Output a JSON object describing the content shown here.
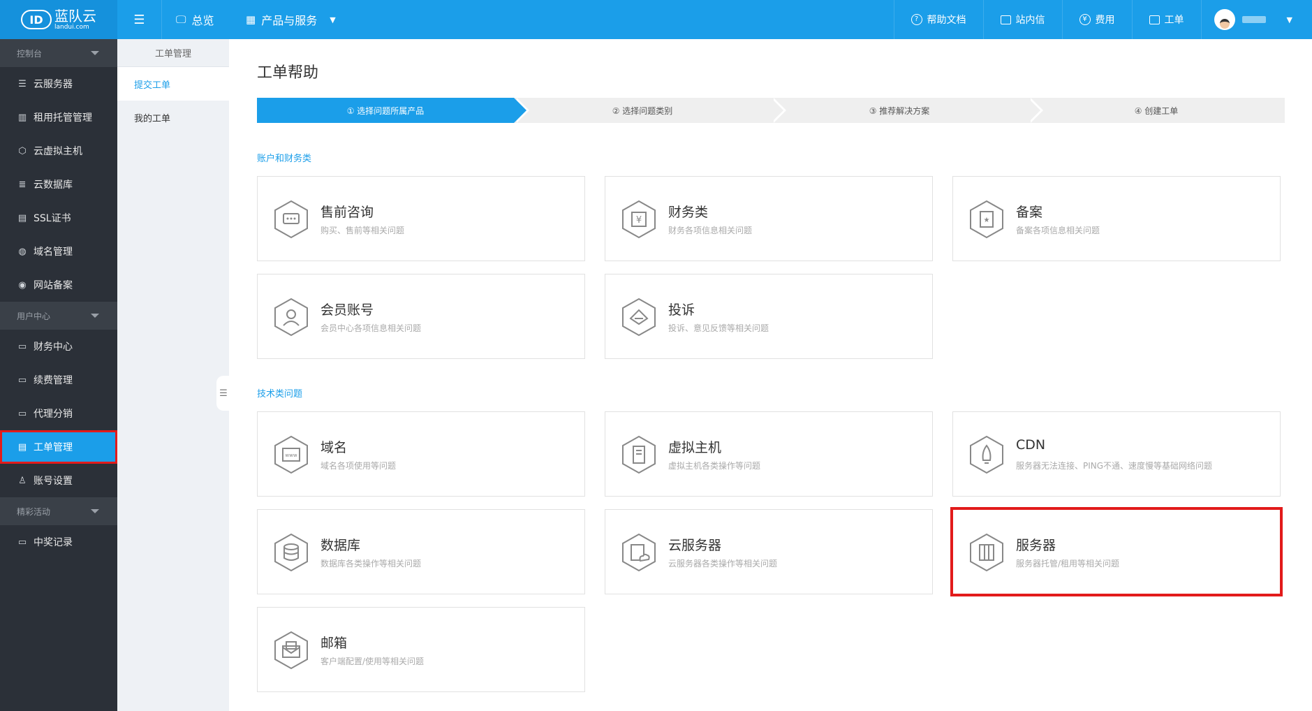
{
  "topbar": {
    "logo_cn": "蓝队云",
    "logo_en": "landui.com",
    "nav": [
      {
        "label": "总览",
        "icon": "monitor-icon"
      },
      {
        "label": "产品与服务",
        "icon": "grid-icon"
      }
    ],
    "right": [
      {
        "label": "帮助文档",
        "icon": "help-icon"
      },
      {
        "label": "站内信",
        "icon": "mail-icon"
      },
      {
        "label": "费用",
        "icon": "yen-icon"
      },
      {
        "label": "工单",
        "icon": "ticket-icon"
      }
    ]
  },
  "sidebar": {
    "groups": [
      {
        "label": "控制台",
        "items": [
          {
            "label": "云服务器",
            "icon": "server-icon"
          },
          {
            "label": "租用托管管理",
            "icon": "rack-icon"
          },
          {
            "label": "云虚拟主机",
            "icon": "cube-icon"
          },
          {
            "label": "云数据库",
            "icon": "database-icon"
          },
          {
            "label": "SSL证书",
            "icon": "certificate-icon"
          },
          {
            "label": "域名管理",
            "icon": "globe-icon"
          },
          {
            "label": "网站备案",
            "icon": "record-icon"
          }
        ]
      },
      {
        "label": "用户中心",
        "items": [
          {
            "label": "财务中心",
            "icon": "finance-icon"
          },
          {
            "label": "续费管理",
            "icon": "renew-icon"
          },
          {
            "label": "代理分销",
            "icon": "agent-icon"
          },
          {
            "label": "工单管理",
            "icon": "ticket-icon",
            "active": true
          },
          {
            "label": "账号设置",
            "icon": "user-icon"
          }
        ]
      },
      {
        "label": "精彩活动",
        "items": [
          {
            "label": "中奖记录",
            "icon": "prize-icon"
          }
        ]
      }
    ]
  },
  "submenu": {
    "header": "工单管理",
    "items": [
      "提交工单",
      "我的工单"
    ]
  },
  "main": {
    "title": "工单帮助",
    "steps": [
      "① 选择问题所属产品",
      "② 选择问题类别",
      "③ 推荐解决方案",
      "④ 创建工单"
    ],
    "sections": [
      {
        "title": "账户和财务类",
        "cards": [
          {
            "title": "售前咨询",
            "desc": "购买、售前等相关问题",
            "icon": "chat-icon"
          },
          {
            "title": "财务类",
            "desc": "财务各项信息相关问题",
            "icon": "yen-icon"
          },
          {
            "title": "备案",
            "desc": "备案各项信息相关问题",
            "icon": "record-icon"
          },
          {
            "title": "会员账号",
            "desc": "会员中心各项信息相关问题",
            "icon": "user-icon"
          },
          {
            "title": "投诉",
            "desc": "投诉、意见反馈等相关问题",
            "icon": "complaint-icon"
          }
        ]
      },
      {
        "title": "技术类问题",
        "cards": [
          {
            "title": "域名",
            "desc": "域名各项使用等问题",
            "icon": "www-icon"
          },
          {
            "title": "虚拟主机",
            "desc": "虚拟主机各类操作等问题",
            "icon": "host-icon"
          },
          {
            "title": "CDN",
            "desc": "服务器无法连接、PING不通、速度慢等基础网络问题",
            "icon": "rocket-icon"
          },
          {
            "title": "数据库",
            "desc": "数据库各类操作等相关问题",
            "icon": "database-icon"
          },
          {
            "title": "云服务器",
            "desc": "云服务器各类操作等相关问题",
            "icon": "cloud-server-icon"
          },
          {
            "title": "服务器",
            "desc": "服务器托管/租用等相关问题",
            "icon": "server-icon",
            "highlighted": true
          },
          {
            "title": "邮箱",
            "desc": "客户端配置/使用等相关问题",
            "icon": "mail-icon"
          }
        ]
      }
    ]
  },
  "colors": {
    "accent": "#1b9ee9",
    "sidebar_bg": "#2b3038",
    "highlight": "#e21b1b"
  }
}
